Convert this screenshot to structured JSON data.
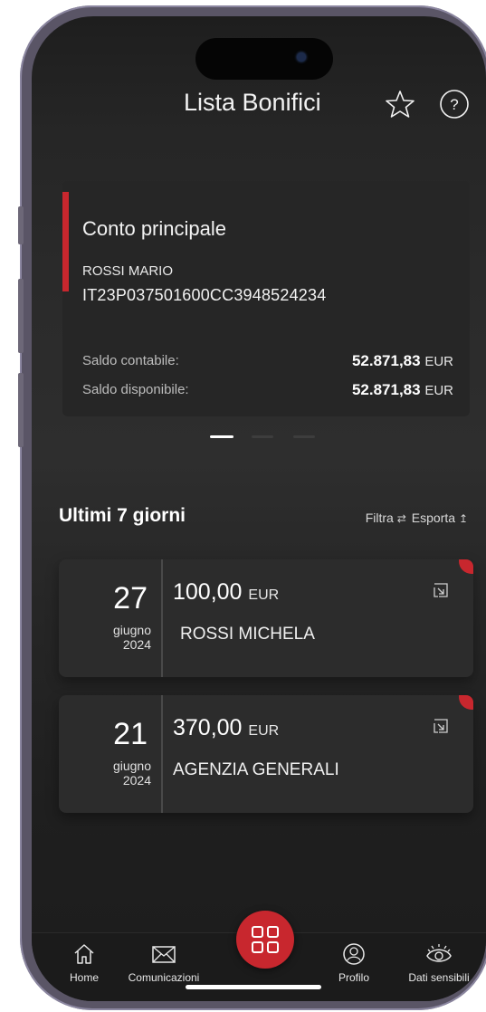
{
  "header": {
    "title": "Lista Bonifici",
    "star_icon": "star-icon",
    "help_icon": "help-icon"
  },
  "account_card": {
    "name": "Conto principale",
    "holder": "ROSSI MARIO",
    "iban": "IT23P037501600CC3948524234",
    "balance_accounting_label": "Saldo contabile:",
    "balance_accounting_value": "52.871,83",
    "balance_available_label": "Saldo disponibile:",
    "balance_available_value": "52.871,83",
    "currency": "EUR",
    "accent_color": "#c8272e"
  },
  "pager": {
    "pages": 3,
    "active": 0
  },
  "section": {
    "title": "Ultimi 7 giorni",
    "filter_label": "Filtra",
    "export_label": "Esporta"
  },
  "transactions": [
    {
      "day": "27",
      "month": "giugno",
      "year": "2024",
      "amount": "100,00",
      "currency": "EUR",
      "payee": "ROSSI MICHELA"
    },
    {
      "day": "21",
      "month": "giugno",
      "year": "2024",
      "amount": "370,00",
      "currency": "EUR",
      "payee": "AGENZIA GENERALI"
    }
  ],
  "nav": {
    "home": "Home",
    "messages": "Comunicazioni",
    "profile": "Profilo",
    "sensitive": "Dati sensibili"
  }
}
